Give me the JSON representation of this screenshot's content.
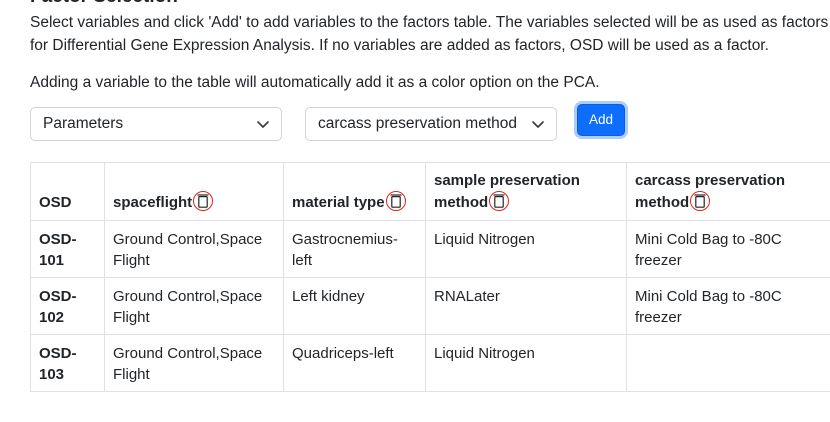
{
  "section": {
    "title": "Factor Selection",
    "intro": "Select variables and click 'Add' to add variables to the factors table. The variables selected will be as used as factors for Differential Gene Expression Analysis. If no variables are added as factors, OSD will be used as a factor.",
    "note": "Adding a variable to the table will automatically add it as a color option on the PCA."
  },
  "controls": {
    "parameters_select": {
      "value": "Parameters"
    },
    "variable_select": {
      "value": "carcass preservation method"
    },
    "add_button": {
      "label": "Add"
    }
  },
  "table": {
    "headers": [
      {
        "label": "OSD",
        "removable": false
      },
      {
        "label": "spaceflight",
        "removable": true
      },
      {
        "label": "material type",
        "removable": true
      },
      {
        "label": "sample preservation method",
        "removable": true
      },
      {
        "label": "carcass preservation method",
        "removable": true
      }
    ],
    "rows": [
      {
        "osd": "OSD-101",
        "spaceflight": "Ground Control,Space Flight",
        "material_type": "Gastrocnemius-left",
        "sample_preservation_method": "Liquid Nitrogen",
        "carcass_preservation_method": "Mini Cold Bag to -80C freezer"
      },
      {
        "osd": "OSD-102",
        "spaceflight": "Ground Control,Space Flight",
        "material_type": "Left kidney",
        "sample_preservation_method": "RNALater",
        "carcass_preservation_method": "Mini Cold Bag to -80C freezer"
      },
      {
        "osd": "OSD-103",
        "spaceflight": "Ground Control,Space Flight",
        "material_type": "Quadriceps-left",
        "sample_preservation_method": "Liquid Nitrogen",
        "carcass_preservation_method": ""
      }
    ]
  },
  "icons": {
    "chevron": "chevron-down-icon",
    "remove": "trash-icon"
  },
  "colors": {
    "primary": "#0d6efd",
    "remove_icon_outline": "#e0241b",
    "border": "#dee2e6"
  }
}
